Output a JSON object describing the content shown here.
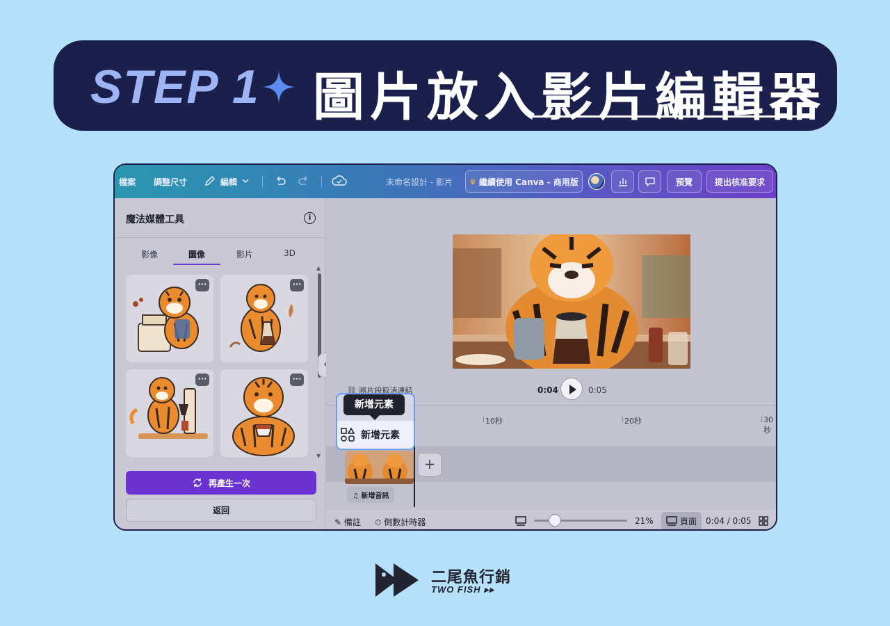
{
  "banner": {
    "step": "STEP 1",
    "title": "圖片放入影片編輯器",
    "accent_color": "#5c8cf0",
    "bg_color": "#1b1f4c"
  },
  "toolbar": {
    "file": "檔案",
    "resize": "調整尺寸",
    "edit": "編輯",
    "doc_title": "未命名設計 - 影片",
    "upgrade": "繼續使用 Canva - 商用版",
    "preview": "預覽",
    "submit": "提出核准要求"
  },
  "panel": {
    "title": "魔法媒體工具",
    "tabs": [
      {
        "label": "影像",
        "active": false
      },
      {
        "label": "圖像",
        "active": true
      },
      {
        "label": "影片",
        "active": false
      },
      {
        "label": "3D",
        "active": false
      }
    ],
    "more_label": "···",
    "regenerate": "再產生一次",
    "back": "返回"
  },
  "player": {
    "current_time": "0:04",
    "total_time": "0:05",
    "unlink": "將片段取消連結"
  },
  "timeline": {
    "marks": [
      "10秒",
      "20秒",
      "30秒"
    ],
    "add_audio": "新增音訊"
  },
  "callout": {
    "tooltip": "新增元素",
    "button": "新增元素"
  },
  "bottombar": {
    "notes": "備註",
    "timer": "倒數計時器",
    "zoom": "21%",
    "zoom_level": 0.21,
    "page": "頁面",
    "time": "0:04 / 0:05"
  },
  "brand": {
    "name": "二尾魚行銷",
    "sub": "TWO FISH ▸▸"
  },
  "icons": [
    "sparkle-icon",
    "pencil-icon",
    "chevron-down-icon",
    "undo-icon",
    "redo-icon",
    "cloud-check-icon",
    "crown-icon",
    "chart-icon",
    "comment-icon",
    "info-icon",
    "refresh-icon",
    "play-icon",
    "unlink-icon",
    "shapes-icon",
    "music-icon",
    "notes-icon",
    "timer-icon",
    "grid-icon"
  ]
}
